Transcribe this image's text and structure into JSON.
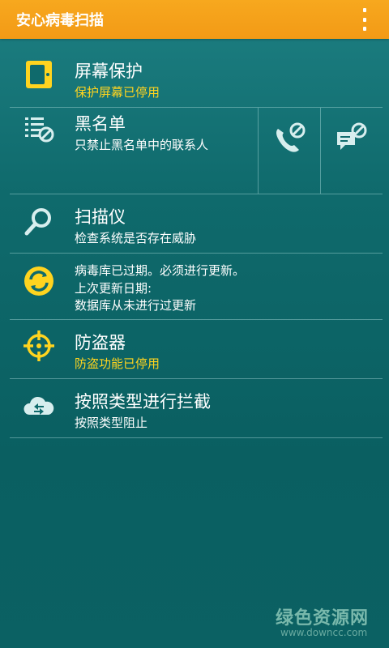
{
  "app": {
    "title": "安心病毒扫描"
  },
  "colors": {
    "accent": "#f39a16",
    "warning_text": "#ffd41f",
    "background": "#0f6a6c"
  },
  "items": {
    "screen_protect": {
      "title": "屏幕保护",
      "subtitle": "保护屏幕已停用",
      "icon": "screen-lock-icon"
    },
    "blacklist": {
      "title": "黑名单",
      "subtitle": "只禁止黑名单中的联系人",
      "icon": "blacklist-icon",
      "actions": [
        {
          "icon": "block-call-icon"
        },
        {
          "icon": "block-sms-icon"
        }
      ]
    },
    "scanner": {
      "title": "扫描仪",
      "subtitle": "检查系统是否存在威胁",
      "icon": "search-icon"
    },
    "update": {
      "line1": "病毒库已过期。必须进行更新。",
      "line2": "上次更新日期:",
      "line3": "数据库从未进行过更新",
      "icon": "update-icon"
    },
    "antitheft": {
      "title": "防盗器",
      "subtitle": "防盗功能已停用",
      "icon": "crosshair-icon"
    },
    "type_block": {
      "title": "按照类型进行拦截",
      "subtitle": "按照类型阻止",
      "icon": "cloud-filter-icon"
    }
  },
  "watermark": {
    "line1": "绿色资源网",
    "line2": "www.downcc.com"
  }
}
